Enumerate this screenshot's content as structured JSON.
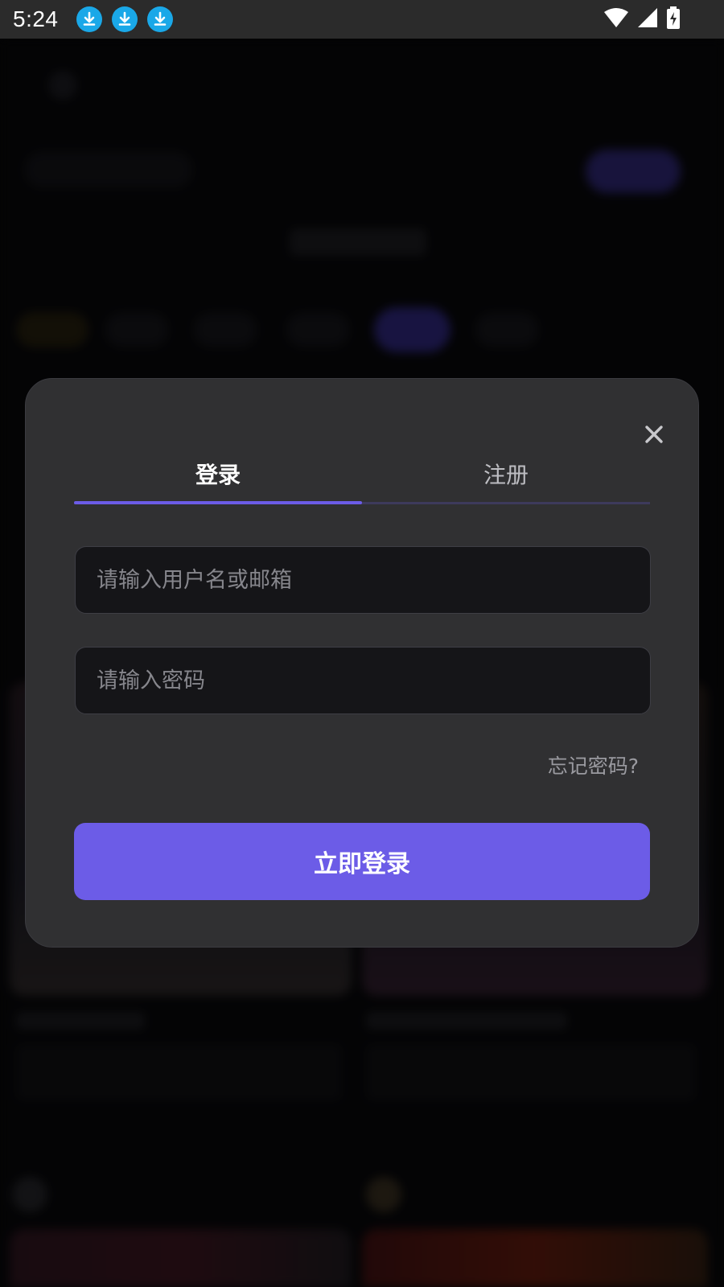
{
  "status_bar": {
    "time": "5:24",
    "notification_icons": [
      "download-icon",
      "download-icon",
      "download-icon"
    ],
    "right_icons": [
      "wifi-icon",
      "signal-icon",
      "battery-charging-icon"
    ]
  },
  "login_dialog": {
    "tabs": [
      {
        "label": "登录",
        "active": true
      },
      {
        "label": "注册",
        "active": false
      }
    ],
    "username_placeholder": "请输入用户名或邮箱",
    "password_placeholder": "请输入密码",
    "forgot_password": "忘记密码?",
    "submit_label": "立即登录",
    "close_icon": "close-icon"
  },
  "colors": {
    "accent": "#6c5ce7",
    "dialog_bg": "#303032",
    "input_bg": "#151518",
    "status_bar_bg": "#2b2b2b",
    "download_badge": "#1aa8e8"
  }
}
